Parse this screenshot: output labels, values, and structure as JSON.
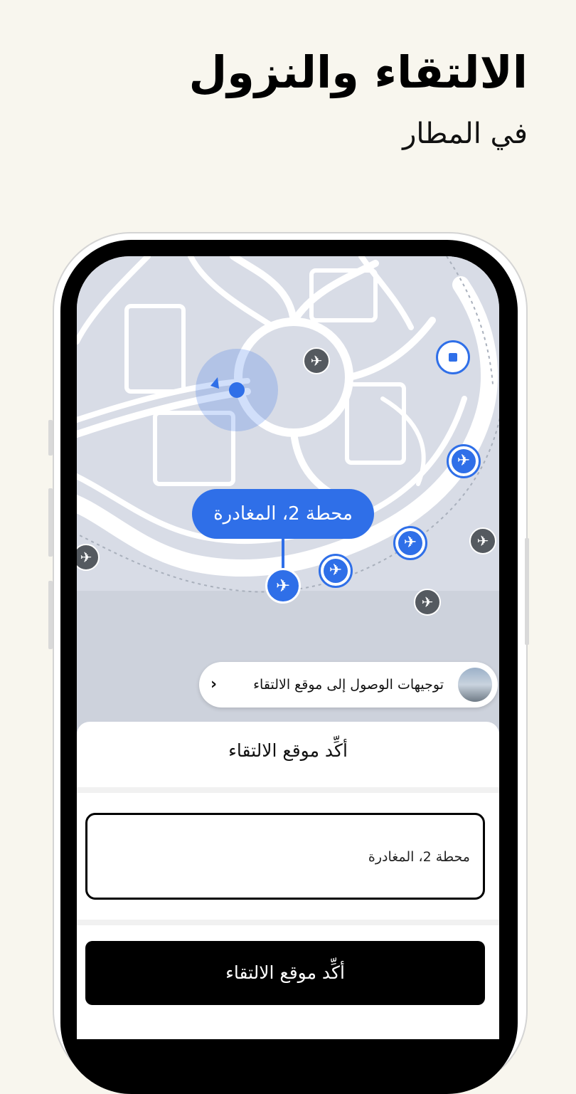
{
  "header": {
    "title": "الالتقاء والنزول",
    "subtitle": "في المطار"
  },
  "map": {
    "callout_label": "محطة 2، المغادرة",
    "accent_color": "#2f6fe8",
    "marker_icon": "airplane-icon",
    "stop_icon": "stop-square-icon"
  },
  "directions_chip": {
    "label": "توجيهات الوصول إلى موقع الالتقاء",
    "chevron": "‹"
  },
  "sheet": {
    "title": "أكِّد موقع الالتقاء",
    "address_value": "محطة 2، المغادرة",
    "confirm_label": "أكِّد موقع الالتقاء"
  }
}
